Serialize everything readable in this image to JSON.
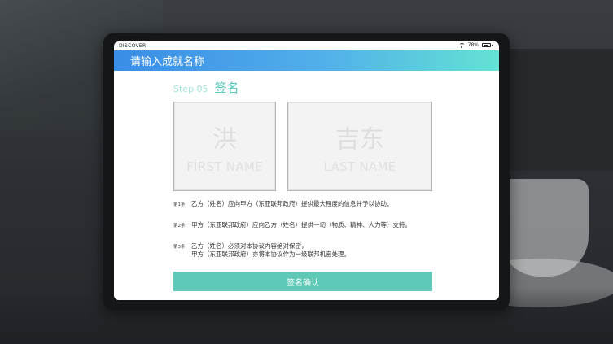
{
  "status_bar": {
    "app_name": "DISCOVER",
    "battery_text": "78%",
    "battery_level": 0.78
  },
  "header": {
    "title": "请输入成就名称"
  },
  "step": {
    "label": "Step 05",
    "title": "签名"
  },
  "signature": {
    "first": {
      "char": "洪",
      "hint": "FIRST NAME"
    },
    "last": {
      "char": "吉东",
      "hint": "LAST NAME"
    }
  },
  "clauses": [
    {
      "num": "第1条",
      "lines": [
        "乙方（姓名）应向甲方（东亚联邦政府）提供最大程度的信息并予以协助。"
      ]
    },
    {
      "num": "第2条",
      "lines": [
        "甲方（东亚联邦政府）应向乙方（姓名）提供一切（物质、精神、人力等）支持。"
      ]
    },
    {
      "num": "第3条",
      "lines": [
        "乙方（姓名）必须对本协议内容绝对保密，",
        "甲方（东亚联邦政府）亦将本协议作为一级联邦机密处理。"
      ]
    }
  ],
  "confirm_button": "签名确认"
}
